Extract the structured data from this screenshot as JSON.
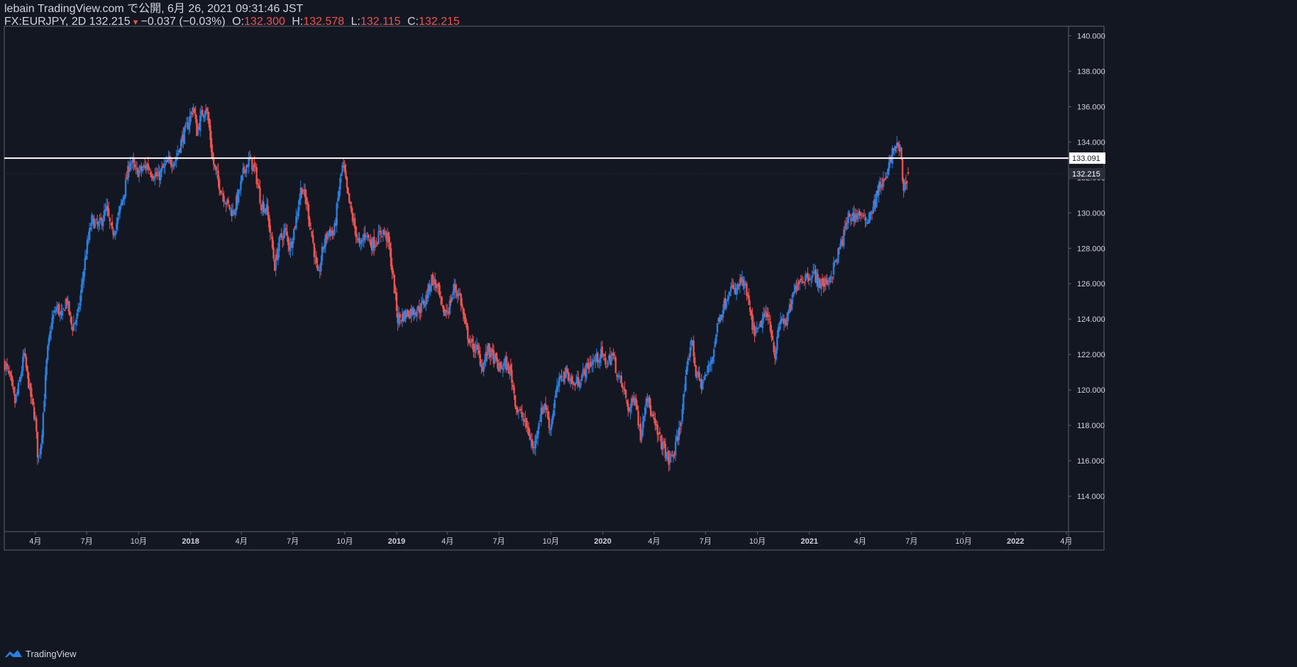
{
  "header": {
    "line1": "lebain TradingView.com で公開, 6月 26, 2021 09:31:46 JST",
    "symbol": "FX:EURJPY, 2D",
    "last": "132.215",
    "change": "−0.037 (−0.03%)",
    "o_label": "O:",
    "o": "132.300",
    "h_label": "H:",
    "h": "132.578",
    "l_label": "L:",
    "l": "132.115",
    "c_label": "C:",
    "c": "132.215"
  },
  "footer": {
    "brand": "TradingView",
    "brand_icon": "tradingview-logo-icon"
  },
  "colors": {
    "background": "#131722",
    "up": "#2a7fe0",
    "down": "#ef5350",
    "grid_border": "#5d606b",
    "text": "#d1d4dc",
    "hline": "#ffffff"
  },
  "chart_data": {
    "type": "candlestick",
    "symbol": "FX:EURJPY",
    "interval": "2D",
    "ylim": [
      112,
      140.5
    ],
    "y_ticks": [
      114,
      116,
      118,
      120,
      122,
      124,
      126,
      128,
      130,
      132,
      134,
      136,
      138,
      140
    ],
    "y_tick_labels": [
      "114.000",
      "116.000",
      "118.000",
      "120.000",
      "122.000",
      "124.000",
      "126.000",
      "128.000",
      "130.000",
      "132.000",
      "134.000",
      "136.000",
      "138.000",
      "140.000"
    ],
    "x_range": [
      "2017-02-05",
      "2022-04-05"
    ],
    "x_ticks": [
      {
        "date": "2017-04-01",
        "label": "4月"
      },
      {
        "date": "2017-07-01",
        "label": "7月"
      },
      {
        "date": "2017-10-01",
        "label": "10月"
      },
      {
        "date": "2018-01-01",
        "label": "2018"
      },
      {
        "date": "2018-04-01",
        "label": "4月"
      },
      {
        "date": "2018-07-01",
        "label": "7月"
      },
      {
        "date": "2018-10-01",
        "label": "10月"
      },
      {
        "date": "2019-01-01",
        "label": "2019"
      },
      {
        "date": "2019-04-01",
        "label": "4月"
      },
      {
        "date": "2019-07-01",
        "label": "7月"
      },
      {
        "date": "2019-10-01",
        "label": "10月"
      },
      {
        "date": "2020-01-01",
        "label": "2020"
      },
      {
        "date": "2020-04-01",
        "label": "4月"
      },
      {
        "date": "2020-07-01",
        "label": "7月"
      },
      {
        "date": "2020-10-01",
        "label": "10月"
      },
      {
        "date": "2021-01-01",
        "label": "2021"
      },
      {
        "date": "2021-04-01",
        "label": "4月"
      },
      {
        "date": "2021-07-01",
        "label": "7月"
      },
      {
        "date": "2021-10-01",
        "label": "10月"
      },
      {
        "date": "2022-01-01",
        "label": "2022"
      },
      {
        "date": "2022-04-01",
        "label": "4月"
      }
    ],
    "horizontal_line": {
      "value": 133.091,
      "label": "133.091"
    },
    "last_price": {
      "value": 132.215,
      "label": "132.215"
    },
    "close_path": [
      {
        "date": "2017-02-06",
        "close": 121.5
      },
      {
        "date": "2017-02-14",
        "close": 120.8
      },
      {
        "date": "2017-02-24",
        "close": 119.3
      },
      {
        "date": "2017-03-04",
        "close": 120.4
      },
      {
        "date": "2017-03-12",
        "close": 122.0
      },
      {
        "date": "2017-03-22",
        "close": 120.0
      },
      {
        "date": "2017-04-01",
        "close": 118.3
      },
      {
        "date": "2017-04-06",
        "close": 116.0
      },
      {
        "date": "2017-04-12",
        "close": 117.3
      },
      {
        "date": "2017-04-22",
        "close": 122.0
      },
      {
        "date": "2017-05-01",
        "close": 124.0
      },
      {
        "date": "2017-05-10",
        "close": 124.7
      },
      {
        "date": "2017-05-18",
        "close": 124.0
      },
      {
        "date": "2017-05-26",
        "close": 125.2
      },
      {
        "date": "2017-06-05",
        "close": 123.5
      },
      {
        "date": "2017-06-16",
        "close": 124.3
      },
      {
        "date": "2017-06-30",
        "close": 127.8
      },
      {
        "date": "2017-07-10",
        "close": 129.6
      },
      {
        "date": "2017-07-22",
        "close": 129.2
      },
      {
        "date": "2017-08-05",
        "close": 130.2
      },
      {
        "date": "2017-08-15",
        "close": 128.8
      },
      {
        "date": "2017-08-25",
        "close": 129.6
      },
      {
        "date": "2017-09-06",
        "close": 131.3
      },
      {
        "date": "2017-09-16",
        "close": 133.0
      },
      {
        "date": "2017-09-26",
        "close": 132.3
      },
      {
        "date": "2017-10-06",
        "close": 132.4
      },
      {
        "date": "2017-10-16",
        "close": 132.7
      },
      {
        "date": "2017-10-26",
        "close": 132.2
      },
      {
        "date": "2017-11-05",
        "close": 132.0
      },
      {
        "date": "2017-11-15",
        "close": 132.6
      },
      {
        "date": "2017-11-25",
        "close": 132.9
      },
      {
        "date": "2017-12-05",
        "close": 133.0
      },
      {
        "date": "2017-12-15",
        "close": 134.0
      },
      {
        "date": "2017-12-27",
        "close": 135.0
      },
      {
        "date": "2018-01-06",
        "close": 136.0
      },
      {
        "date": "2018-01-12",
        "close": 134.6
      },
      {
        "date": "2018-01-20",
        "close": 135.5
      },
      {
        "date": "2018-01-28",
        "close": 136.0
      },
      {
        "date": "2018-02-03",
        "close": 134.8
      },
      {
        "date": "2018-02-09",
        "close": 133.0
      },
      {
        "date": "2018-02-15",
        "close": 132.2
      },
      {
        "date": "2018-02-25",
        "close": 131.2
      },
      {
        "date": "2018-03-07",
        "close": 130.5
      },
      {
        "date": "2018-03-17",
        "close": 130.0
      },
      {
        "date": "2018-03-27",
        "close": 131.0
      },
      {
        "date": "2018-04-06",
        "close": 132.5
      },
      {
        "date": "2018-04-16",
        "close": 133.0
      },
      {
        "date": "2018-04-26",
        "close": 132.3
      },
      {
        "date": "2018-05-06",
        "close": 130.5
      },
      {
        "date": "2018-05-16",
        "close": 130.2
      },
      {
        "date": "2018-05-24",
        "close": 128.5
      },
      {
        "date": "2018-05-30",
        "close": 127.0
      },
      {
        "date": "2018-06-08",
        "close": 128.5
      },
      {
        "date": "2018-06-18",
        "close": 129.0
      },
      {
        "date": "2018-06-26",
        "close": 128.0
      },
      {
        "date": "2018-07-06",
        "close": 129.5
      },
      {
        "date": "2018-07-16",
        "close": 131.5
      },
      {
        "date": "2018-07-26",
        "close": 130.5
      },
      {
        "date": "2018-08-05",
        "close": 128.5
      },
      {
        "date": "2018-08-15",
        "close": 126.2
      },
      {
        "date": "2018-08-23",
        "close": 128.0
      },
      {
        "date": "2018-09-02",
        "close": 129.0
      },
      {
        "date": "2018-09-12",
        "close": 128.8
      },
      {
        "date": "2018-09-22",
        "close": 131.6
      },
      {
        "date": "2018-09-28",
        "close": 132.8
      },
      {
        "date": "2018-10-06",
        "close": 131.0
      },
      {
        "date": "2018-10-16",
        "close": 129.5
      },
      {
        "date": "2018-10-28",
        "close": 128.0
      },
      {
        "date": "2018-11-07",
        "close": 129.0
      },
      {
        "date": "2018-11-17",
        "close": 128.2
      },
      {
        "date": "2018-11-27",
        "close": 128.5
      },
      {
        "date": "2018-12-07",
        "close": 129.0
      },
      {
        "date": "2018-12-17",
        "close": 128.5
      },
      {
        "date": "2018-12-27",
        "close": 126.0
      },
      {
        "date": "2019-01-03",
        "close": 124.0
      },
      {
        "date": "2019-01-13",
        "close": 124.2
      },
      {
        "date": "2019-01-23",
        "close": 124.4
      },
      {
        "date": "2019-02-02",
        "close": 124.5
      },
      {
        "date": "2019-02-12",
        "close": 124.6
      },
      {
        "date": "2019-02-22",
        "close": 125.2
      },
      {
        "date": "2019-03-04",
        "close": 126.3
      },
      {
        "date": "2019-03-14",
        "close": 125.8
      },
      {
        "date": "2019-03-24",
        "close": 124.3
      },
      {
        "date": "2019-04-03",
        "close": 124.6
      },
      {
        "date": "2019-04-13",
        "close": 125.8
      },
      {
        "date": "2019-04-23",
        "close": 125.3
      },
      {
        "date": "2019-05-03",
        "close": 123.5
      },
      {
        "date": "2019-05-13",
        "close": 122.5
      },
      {
        "date": "2019-05-23",
        "close": 122.3
      },
      {
        "date": "2019-06-02",
        "close": 121.3
      },
      {
        "date": "2019-06-12",
        "close": 122.3
      },
      {
        "date": "2019-06-22",
        "close": 121.8
      },
      {
        "date": "2019-07-02",
        "close": 121.2
      },
      {
        "date": "2019-07-12",
        "close": 121.5
      },
      {
        "date": "2019-07-22",
        "close": 121.0
      },
      {
        "date": "2019-08-01",
        "close": 119.0
      },
      {
        "date": "2019-08-11",
        "close": 118.5
      },
      {
        "date": "2019-08-21",
        "close": 117.8
      },
      {
        "date": "2019-08-31",
        "close": 116.6
      },
      {
        "date": "2019-09-10",
        "close": 118.3
      },
      {
        "date": "2019-09-20",
        "close": 119.3
      },
      {
        "date": "2019-09-30",
        "close": 117.8
      },
      {
        "date": "2019-10-10",
        "close": 119.8
      },
      {
        "date": "2019-10-20",
        "close": 120.8
      },
      {
        "date": "2019-10-30",
        "close": 121.0
      },
      {
        "date": "2019-11-09",
        "close": 120.3
      },
      {
        "date": "2019-11-19",
        "close": 120.5
      },
      {
        "date": "2019-11-29",
        "close": 121.0
      },
      {
        "date": "2019-12-09",
        "close": 121.5
      },
      {
        "date": "2019-12-19",
        "close": 121.7
      },
      {
        "date": "2019-12-29",
        "close": 122.0
      },
      {
        "date": "2020-01-08",
        "close": 121.5
      },
      {
        "date": "2020-01-18",
        "close": 122.0
      },
      {
        "date": "2020-01-28",
        "close": 120.8
      },
      {
        "date": "2020-02-07",
        "close": 120.0
      },
      {
        "date": "2020-02-17",
        "close": 118.8
      },
      {
        "date": "2020-02-27",
        "close": 119.8
      },
      {
        "date": "2020-03-08",
        "close": 117.3
      },
      {
        "date": "2020-03-18",
        "close": 119.8
      },
      {
        "date": "2020-03-28",
        "close": 118.5
      },
      {
        "date": "2020-04-07",
        "close": 117.5
      },
      {
        "date": "2020-04-17",
        "close": 116.8
      },
      {
        "date": "2020-04-27",
        "close": 116.0
      },
      {
        "date": "2020-05-07",
        "close": 116.5
      },
      {
        "date": "2020-05-17",
        "close": 118.0
      },
      {
        "date": "2020-05-27",
        "close": 120.5
      },
      {
        "date": "2020-06-06",
        "close": 123.0
      },
      {
        "date": "2020-06-14",
        "close": 121.0
      },
      {
        "date": "2020-06-24",
        "close": 120.3
      },
      {
        "date": "2020-07-04",
        "close": 121.0
      },
      {
        "date": "2020-07-14",
        "close": 122.0
      },
      {
        "date": "2020-07-24",
        "close": 124.0
      },
      {
        "date": "2020-08-03",
        "close": 124.8
      },
      {
        "date": "2020-08-13",
        "close": 125.8
      },
      {
        "date": "2020-08-23",
        "close": 125.5
      },
      {
        "date": "2020-09-02",
        "close": 126.2
      },
      {
        "date": "2020-09-12",
        "close": 125.5
      },
      {
        "date": "2020-09-22",
        "close": 123.5
      },
      {
        "date": "2020-10-02",
        "close": 123.2
      },
      {
        "date": "2020-10-12",
        "close": 124.2
      },
      {
        "date": "2020-10-22",
        "close": 124.0
      },
      {
        "date": "2020-11-01",
        "close": 122.0
      },
      {
        "date": "2020-11-11",
        "close": 124.0
      },
      {
        "date": "2020-11-21",
        "close": 123.8
      },
      {
        "date": "2020-12-01",
        "close": 125.0
      },
      {
        "date": "2020-12-11",
        "close": 126.2
      },
      {
        "date": "2020-12-21",
        "close": 126.3
      },
      {
        "date": "2020-12-31",
        "close": 126.5
      },
      {
        "date": "2021-01-10",
        "close": 126.5
      },
      {
        "date": "2021-01-20",
        "close": 126.0
      },
      {
        "date": "2021-01-30",
        "close": 126.0
      },
      {
        "date": "2021-02-09",
        "close": 126.5
      },
      {
        "date": "2021-02-19",
        "close": 127.5
      },
      {
        "date": "2021-03-01",
        "close": 128.5
      },
      {
        "date": "2021-03-11",
        "close": 129.8
      },
      {
        "date": "2021-03-21",
        "close": 129.8
      },
      {
        "date": "2021-03-31",
        "close": 130.0
      },
      {
        "date": "2021-04-08",
        "close": 129.5
      },
      {
        "date": "2021-04-16",
        "close": 129.8
      },
      {
        "date": "2021-04-26",
        "close": 130.5
      },
      {
        "date": "2021-05-06",
        "close": 131.6
      },
      {
        "date": "2021-05-16",
        "close": 131.8
      },
      {
        "date": "2021-05-26",
        "close": 133.2
      },
      {
        "date": "2021-06-03",
        "close": 133.8
      },
      {
        "date": "2021-06-11",
        "close": 133.5
      },
      {
        "date": "2021-06-17",
        "close": 131.3
      },
      {
        "date": "2021-06-25",
        "close": 132.215
      }
    ]
  }
}
